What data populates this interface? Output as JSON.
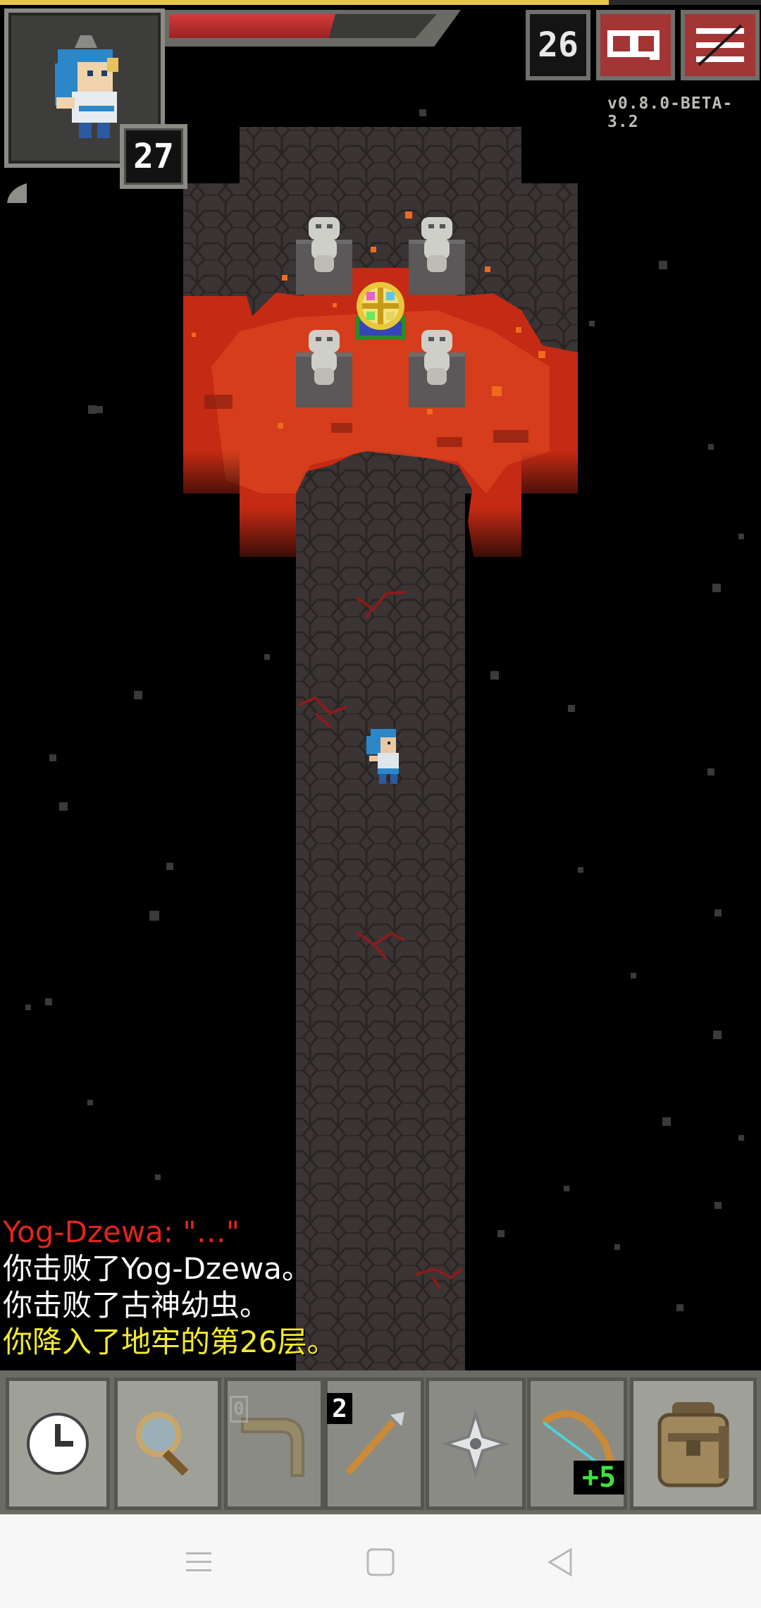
{
  "hud": {
    "hero_level": "27",
    "depth": "26",
    "version": "v0.8.0-BETA-3.2",
    "health_fraction": 0.62,
    "experience_fraction": 0.8
  },
  "log": [
    {
      "text": "Yog-Dzewa: \"…\"",
      "color": "#e0251e"
    },
    {
      "text": "你击败了Yog-Dzewa。",
      "color": "#ffffff"
    },
    {
      "text": "你击败了古神幼虫。",
      "color": "#ffffff"
    },
    {
      "text": "你降入了地牢的第26层。",
      "color": "#f2ea2e"
    }
  ],
  "toolbar": {
    "wait_icon": "clock-icon",
    "search_icon": "magnifier-icon",
    "slots": [
      {
        "item": "boomerang-icon",
        "count": "0",
        "dimmed": true
      },
      {
        "item": "spear-icon",
        "count": "2",
        "dimmed": false
      },
      {
        "item": "shuriken-icon",
        "count": "",
        "dimmed": false
      },
      {
        "item": "bow-icon",
        "count": "+5",
        "dimmed": false
      }
    ],
    "backpack_icon": "backpack-icon"
  },
  "navbar": {
    "menu_icon": "recent-apps-icon",
    "home_icon": "home-icon",
    "back_icon": "back-icon"
  },
  "colors": {
    "lava": "#d8321a",
    "floor": "#3b3535",
    "health": "#c83232",
    "experience": "#e7c64e"
  }
}
